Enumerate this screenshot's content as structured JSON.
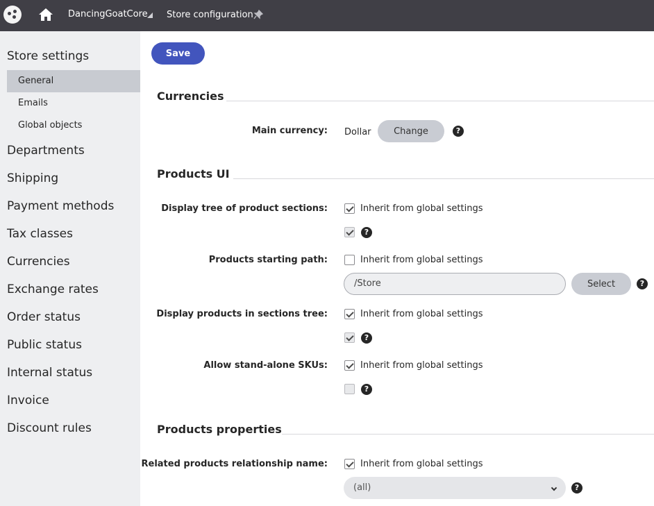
{
  "topbar": {
    "site": "DancingGoatCore",
    "page": "Store configuration"
  },
  "sidebar": {
    "store_settings": "Store settings",
    "sub_items": [
      "General",
      "Emails",
      "Global objects"
    ],
    "items": [
      "Departments",
      "Shipping",
      "Payment methods",
      "Tax classes",
      "Currencies",
      "Exchange rates",
      "Order status",
      "Public status",
      "Internal status",
      "Invoice",
      "Discount rules"
    ]
  },
  "toolbar": {
    "save_label": "Save"
  },
  "currencies": {
    "title": "Currencies",
    "main_currency_label": "Main currency:",
    "main_currency_value": "Dollar",
    "change_label": "Change"
  },
  "products_ui": {
    "title": "Products UI",
    "display_tree_label": "Display tree of product sections:",
    "starting_path_label": "Products starting path:",
    "starting_path_value": "/Store",
    "select_label": "Select",
    "display_products_label": "Display products in sections tree:",
    "standalone_label": "Allow stand-alone SKUs:",
    "inherit_label": "Inherit from global settings"
  },
  "products_properties": {
    "title": "Products properties",
    "related_label": "Related products relationship name:",
    "related_value": "(all)"
  },
  "help_glyph": "?"
}
